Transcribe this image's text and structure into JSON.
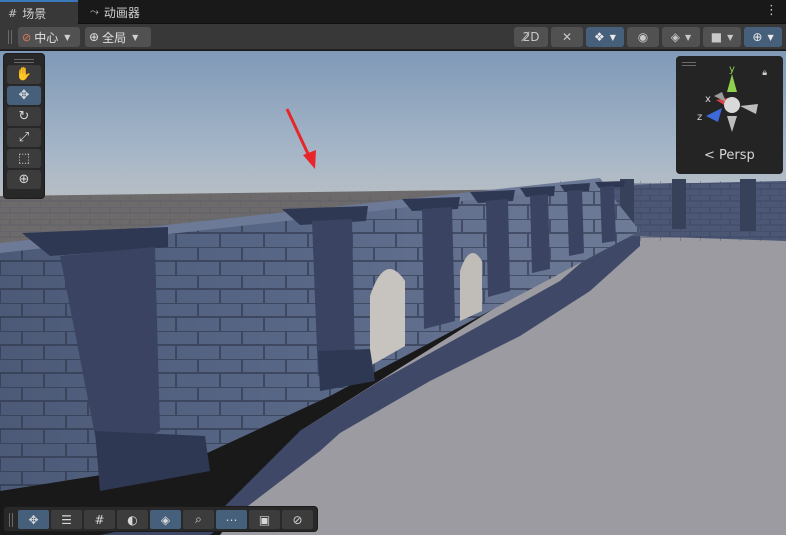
{
  "tabs": [
    {
      "label": "场景",
      "icon": "grid-icon",
      "active": true
    },
    {
      "label": "动画器",
      "icon": "animator-icon",
      "active": false
    }
  ],
  "toolbar": {
    "pivot_label": "中心",
    "space_label": "全局"
  },
  "tools": [
    "hand-tool",
    "move-tool",
    "rotate-tool",
    "scale-tool",
    "rect-tool",
    "transform-tool"
  ],
  "gizmo": {
    "axis_y": "y",
    "axis_x": "x",
    "axis_z": "z",
    "projection_label": "Persp"
  },
  "overlay_tools": [
    "move",
    "hierarchy",
    "grid",
    "shading",
    "layers",
    "search",
    "snap",
    "camera",
    "compass"
  ],
  "colors": {
    "accent": "#46607c",
    "tab_highlight": "#3a79bb",
    "arrow": "#e8262a"
  }
}
